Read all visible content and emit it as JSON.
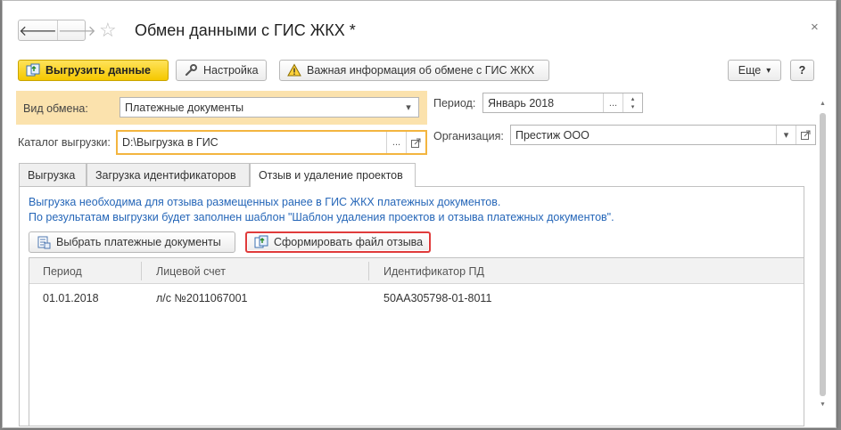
{
  "window": {
    "title": "Обмен данными с ГИС ЖКХ *",
    "nav_back": "🡐",
    "nav_forward": "🡒",
    "star": "☆",
    "close": "×"
  },
  "toolbar": {
    "upload_label": "Выгрузить данные",
    "settings_label": "Настройка",
    "important_label": "Важная информация об обмене с ГИС ЖКХ",
    "more_label": "Еще",
    "more_arrow": "▾",
    "help_label": "?"
  },
  "form": {
    "exchange_type_label": "Вид обмена:",
    "exchange_type_value": "Платежные документы",
    "catalog_label": "Каталог выгрузки:",
    "catalog_value": "D:\\Выгрузка в ГИС",
    "period_label": "Период:",
    "period_value": "Январь 2018",
    "org_label": "Организация:",
    "org_value": "Престиж ООО",
    "ellipsis": "...",
    "dropdown_arrow": "▾"
  },
  "tabs": [
    {
      "label": "Выгрузка"
    },
    {
      "label": "Загрузка идентификаторов"
    },
    {
      "label": "Отзыв и удаление проектов"
    }
  ],
  "panel": {
    "info_line1": "Выгрузка необходима для отзыва размещенных ранее в ГИС ЖКХ платежных документов.",
    "info_line2": "По результатам выгрузки будет заполнен шаблон \"Шаблон удаления проектов и отзыва платежных документов\".",
    "select_docs_label": "Выбрать платежные документы",
    "generate_file_label": "Сформировать файл отзыва"
  },
  "table": {
    "columns": [
      "Период",
      "Лицевой счет",
      "Идентификатор ПД"
    ],
    "rows": [
      [
        "01.01.2018",
        "л/с №2011067001",
        "50АА305798-01-8011"
      ]
    ]
  },
  "colors": {
    "primary_button": "#f5c800",
    "highlight_zone": "#fbe2ad",
    "info_text": "#2566b8",
    "annotation_box": "#e03b3b"
  },
  "icons": {
    "upload": "upload-data-icon",
    "settings": "wrench-icon",
    "warning": "warning-icon",
    "select_docs": "document-list-icon",
    "generate": "generate-file-icon",
    "open": "open-form-icon"
  }
}
